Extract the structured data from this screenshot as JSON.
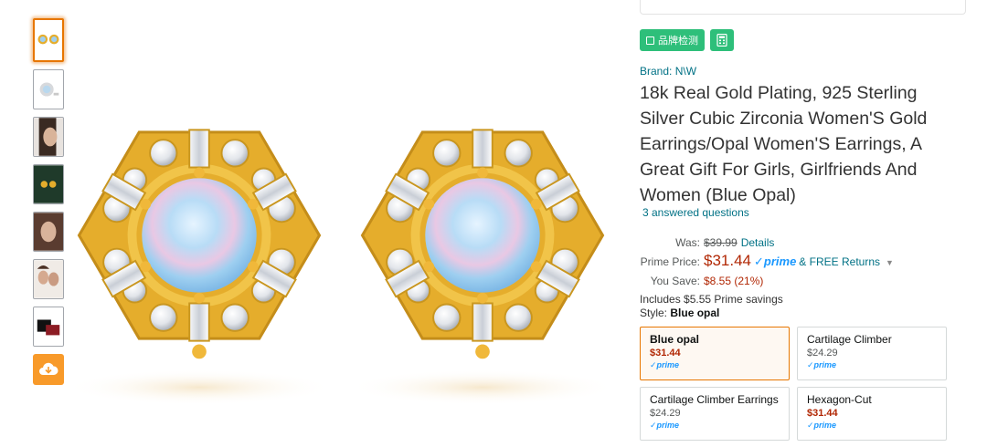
{
  "thumbnails": [
    {
      "name": "thumb-1",
      "selected": true
    },
    {
      "name": "thumb-2",
      "selected": false
    },
    {
      "name": "thumb-3",
      "selected": false
    },
    {
      "name": "thumb-4",
      "selected": false
    },
    {
      "name": "thumb-5",
      "selected": false
    },
    {
      "name": "thumb-6",
      "selected": false
    },
    {
      "name": "thumb-7",
      "selected": false
    }
  ],
  "download_icon": "cloud-download-icon",
  "tags": {
    "brand_check_label": "品牌检测",
    "calculator_icon": "calculator-icon"
  },
  "product": {
    "brand": "Brand: N\\W",
    "title": "18k Real Gold Plating, 925 Sterling Silver Cubic Zirconia Women'S Gold Earrings/Opal Women'S Earrings, A Great Gift For Girls, Girlfriends And Women (Blue Opal)",
    "answered": "3 answered questions"
  },
  "pricing": {
    "was_label": "Was:",
    "was_price": "$39.99",
    "details_link": "Details",
    "prime_label": "Prime Price:",
    "prime_price": "$31.44",
    "prime_badge": "✓prime",
    "free_returns": "& FREE Returns",
    "save_label": "You Save:",
    "save_value": "$8.55 (21%)",
    "includes": "Includes $5.55 Prime savings"
  },
  "style": {
    "label": "Style:",
    "selected": "Blue opal",
    "options": [
      {
        "name": "Blue opal",
        "price": "$31.44",
        "prime": "✓prime"
      },
      {
        "name": "Cartilage Climber",
        "price": "$24.29",
        "prime": "✓prime"
      },
      {
        "name": "Cartilage Climber Earrings",
        "price": "$24.29",
        "prime": "✓prime"
      },
      {
        "name": "Hexagon-Cut",
        "price": "$31.44",
        "prime": "✓prime"
      }
    ]
  },
  "colors": {
    "accent_orange": "#e77600",
    "link_teal": "#007185",
    "price_red": "#b12704",
    "prime_blue": "#1a98ff",
    "tag_green": "#2ebf7a",
    "gold": "#e5ad2c",
    "opal": "#9ecff0"
  }
}
